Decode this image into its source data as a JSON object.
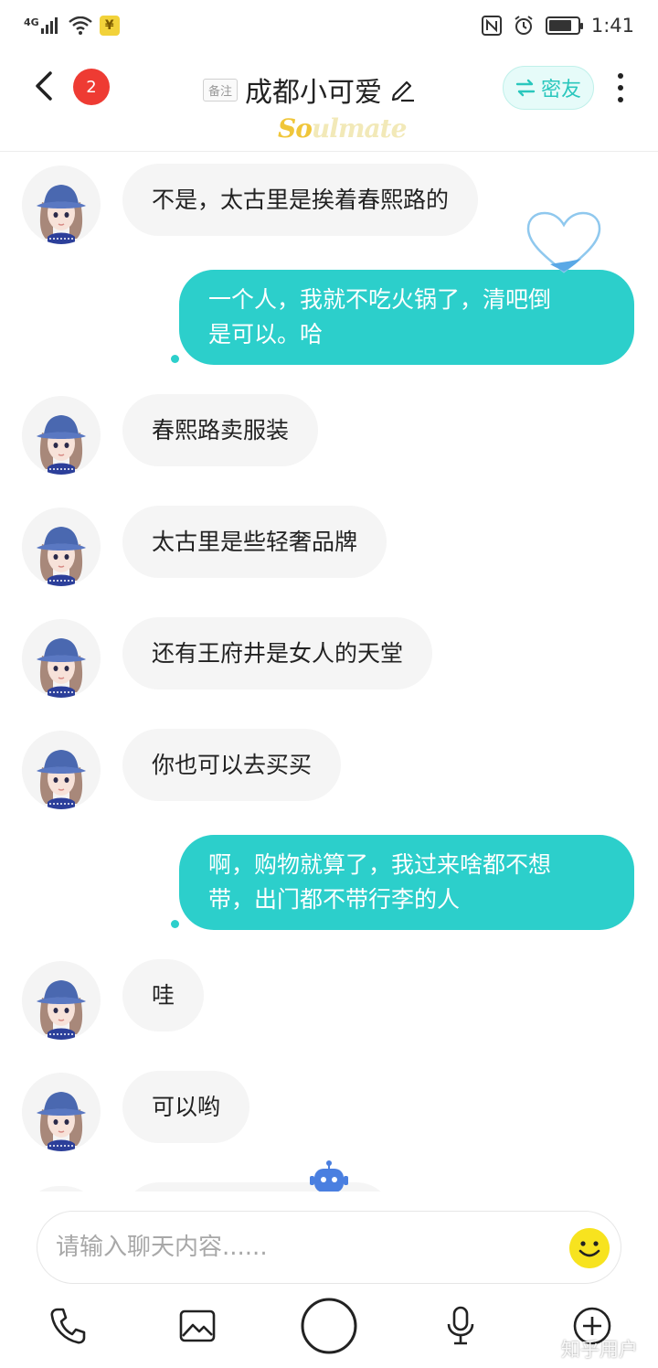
{
  "status_bar": {
    "network": "4G",
    "time": "1:41",
    "yen_badge": "¥",
    "battery_level": 0.8
  },
  "header": {
    "unread_count": "2",
    "remark_tag": "备注",
    "title": "成都小可爱",
    "soulmate_prefix": "So",
    "soulmate_suffix": "ulmate",
    "friend_label": "密友"
  },
  "messages": [
    {
      "side": "in",
      "text": "不是，太古里是挨着春熙路的"
    },
    {
      "side": "out",
      "line1": "一个人，我就不吃火锅了，清吧倒",
      "line2": "是可以。哈"
    },
    {
      "side": "in",
      "text": "春熙路卖服装"
    },
    {
      "side": "in",
      "text": "太古里是些轻奢品牌"
    },
    {
      "side": "in",
      "text": "还有王府井是女人的天堂"
    },
    {
      "side": "in",
      "text": "你也可以去买买"
    },
    {
      "side": "out",
      "line1": "啊，购物就算了，我过来啥都不想",
      "line2": "带，出门都不带行李的人"
    },
    {
      "side": "in",
      "text": "哇"
    },
    {
      "side": "in",
      "text": "可以哟"
    }
  ],
  "input": {
    "placeholder": "请输入聊天内容......",
    "value": ""
  },
  "watermark": "知乎用户",
  "colors": {
    "accent": "#2ccfcb",
    "badge_red": "#ee3b33",
    "incoming_bubble": "#f5f5f5",
    "emoji_yellow": "#f7e31f"
  },
  "icons": {
    "back": "chevron-left-icon",
    "edit": "pencil-icon",
    "swap": "swap-arrows-icon",
    "more": "more-vertical-icon",
    "heart": "heart-icon",
    "robot": "robot-icon",
    "emoji": "smiley-icon",
    "phone": "phone-icon",
    "image": "image-icon",
    "voice": "microphone-icon",
    "add": "plus-circle-icon"
  }
}
